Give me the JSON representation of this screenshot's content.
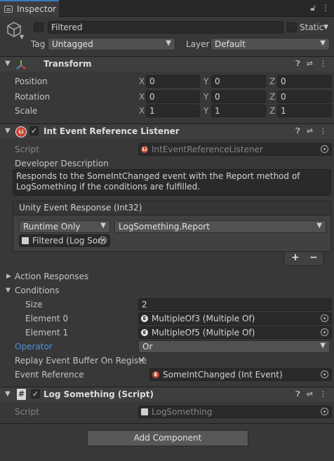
{
  "tab": {
    "title": "Inspector",
    "icons": [
      "lock-icon",
      "kebab-menu-icon"
    ]
  },
  "object": {
    "name": "Filtered",
    "static_label": "Static",
    "tag_label": "Tag",
    "tag_value": "Untagged",
    "layer_label": "Layer",
    "layer_value": "Default"
  },
  "transform": {
    "title": "Transform",
    "rows": [
      {
        "label": "Position",
        "x": "0",
        "y": "0",
        "z": "0"
      },
      {
        "label": "Rotation",
        "x": "0",
        "y": "0",
        "z": "0"
      },
      {
        "label": "Scale",
        "x": "1",
        "y": "1",
        "z": "1"
      }
    ],
    "axes": {
      "x": "X",
      "y": "Y",
      "z": "Z"
    }
  },
  "listener": {
    "title": "Int Event Reference Listener",
    "script_label": "Script",
    "script_value": "IntEventReferenceListener",
    "dev_desc_label": "Developer Description",
    "dev_desc_line1": "Responds to the SomeIntChanged event with the Report method of",
    "dev_desc_line2": "LogSomething if the conditions are fulfilled.",
    "event_header": "Unity Event Response (Int32)",
    "runtime": "Runtime Only",
    "method": "LogSomething.Report",
    "target": "Filtered (Log Som",
    "plus": "+",
    "minus": "−",
    "action_responses": "Action Responses",
    "conditions": "Conditions",
    "size_label": "Size",
    "size_value": "2",
    "element0_label": "Element 0",
    "element0_value": "MultipleOf3 (Multiple Of)",
    "element1_label": "Element 1",
    "element1_value": "MultipleOf5 (Multiple Of)",
    "operator_label": "Operator",
    "operator_value": "Or",
    "replay_label": "Replay Event Buffer On Registe",
    "replay_checked": "✓",
    "event_ref_label": "Event Reference",
    "event_ref_value": "SomeIntChanged (Int Event)"
  },
  "logsomething": {
    "title": "Log Something (Script)",
    "script_label": "Script",
    "script_value": "LogSomething"
  },
  "add_component": "Add Component",
  "colors": {
    "accent": "#3a79bb",
    "operator_label": "#4c8fdb",
    "background": "#383838"
  }
}
